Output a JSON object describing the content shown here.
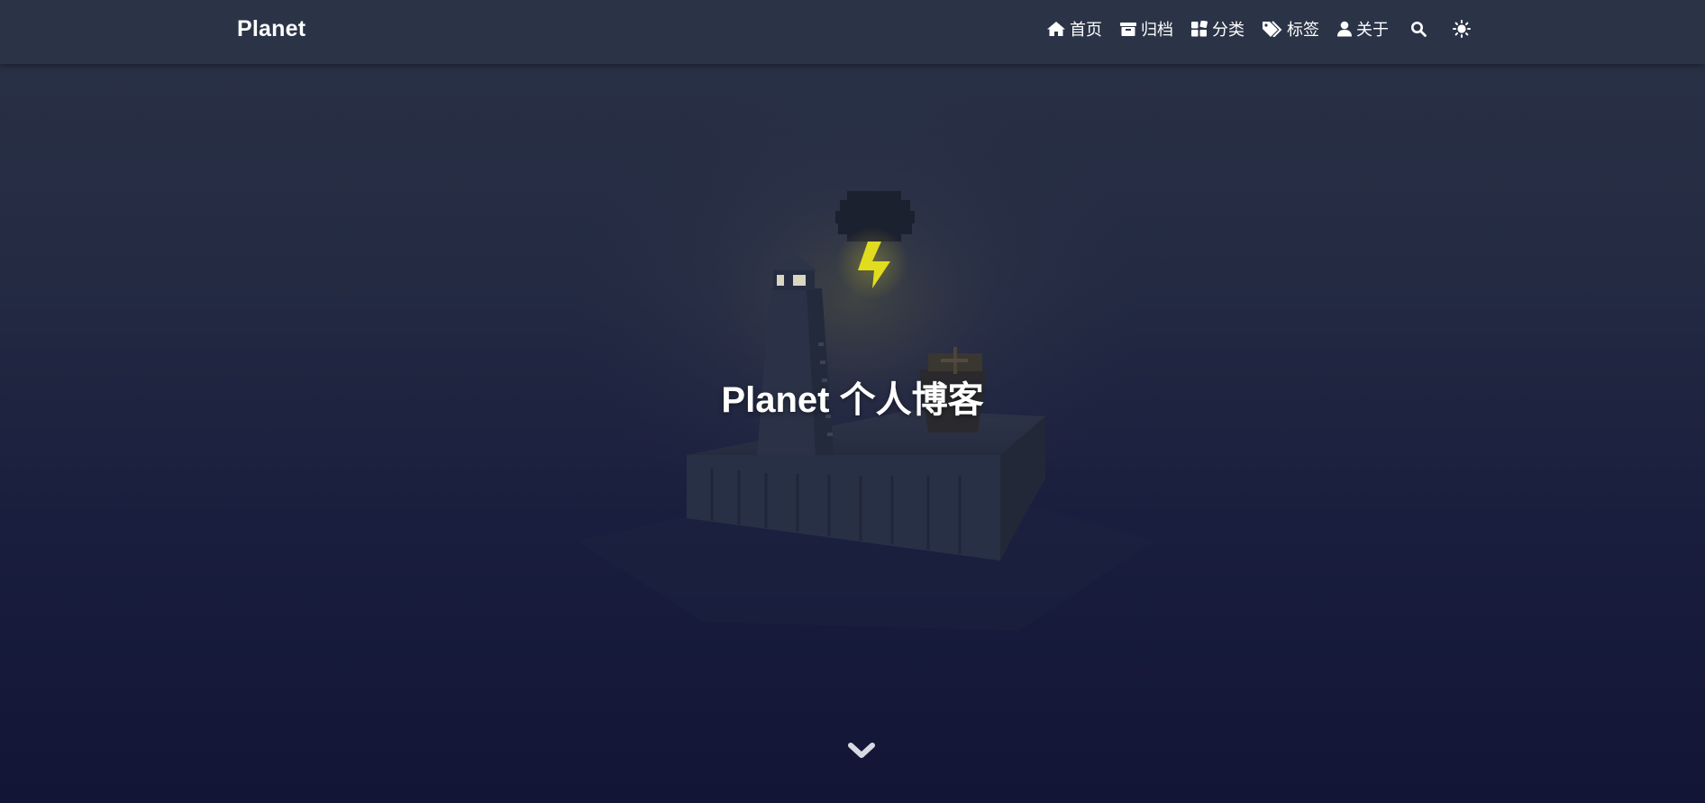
{
  "navbar": {
    "brand": "Planet",
    "items": [
      {
        "label": "首页",
        "icon": "home-icon"
      },
      {
        "label": "归档",
        "icon": "archive-icon"
      },
      {
        "label": "分类",
        "icon": "category-icon"
      },
      {
        "label": "标签",
        "icon": "tags-icon"
      },
      {
        "label": "关于",
        "icon": "user-icon"
      }
    ],
    "search_icon": "search-icon",
    "theme_icon": "sun-icon"
  },
  "hero": {
    "title": "Planet 个人博客",
    "scroll_icon": "chevron-down-icon"
  },
  "colors": {
    "navbar_bg": "#2b3447",
    "hero_top": "#2a3246",
    "hero_bottom": "#121535",
    "bolt": "#e8e21c",
    "text": "#ffffff"
  }
}
